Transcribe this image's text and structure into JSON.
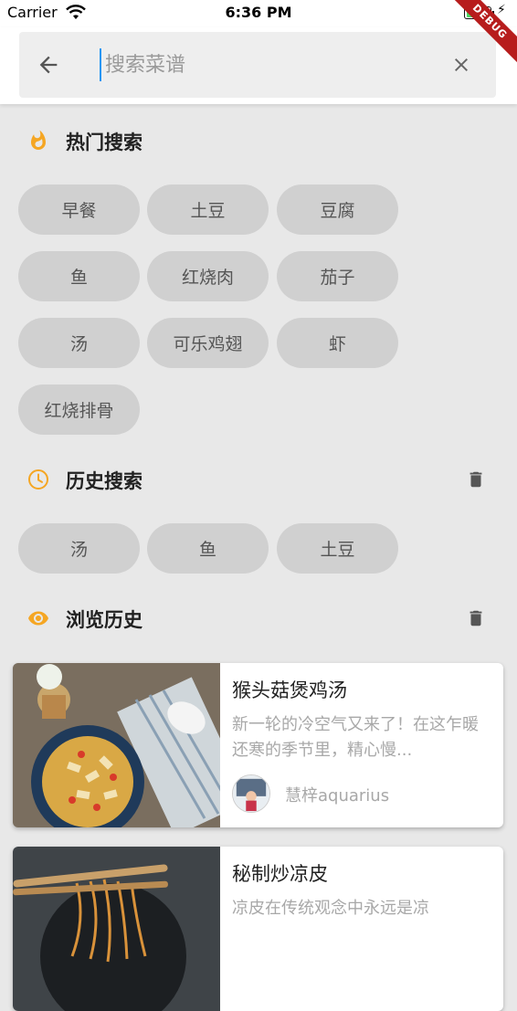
{
  "status_bar": {
    "carrier": "Carrier",
    "time": "6:36 PM",
    "battery_level": 0.85
  },
  "debug_banner": "DEBUG",
  "search": {
    "placeholder": "搜索菜谱",
    "value": ""
  },
  "hot": {
    "title": "热门搜索",
    "items": [
      "早餐",
      "土豆",
      "豆腐",
      "鱼",
      "红烧肉",
      "茄子",
      "汤",
      "可乐鸡翅",
      "虾",
      "红烧排骨"
    ]
  },
  "history": {
    "title": "历史搜索",
    "items": [
      "汤",
      "鱼",
      "土豆"
    ]
  },
  "browse": {
    "title": "浏览历史",
    "cards": [
      {
        "title": "猴头菇煲鸡汤",
        "desc": "新一轮的冷空气又来了！在这乍暖还寒的季节里，精心慢...",
        "author": "慧梓aquarius"
      },
      {
        "title": "秘制炒凉皮",
        "desc": "凉皮在传统观念中永远是凉",
        "author": ""
      }
    ]
  },
  "colors": {
    "accent": "#f5a623",
    "chip_bg": "#d0d0d0",
    "page_bg": "#e8e8e8"
  }
}
